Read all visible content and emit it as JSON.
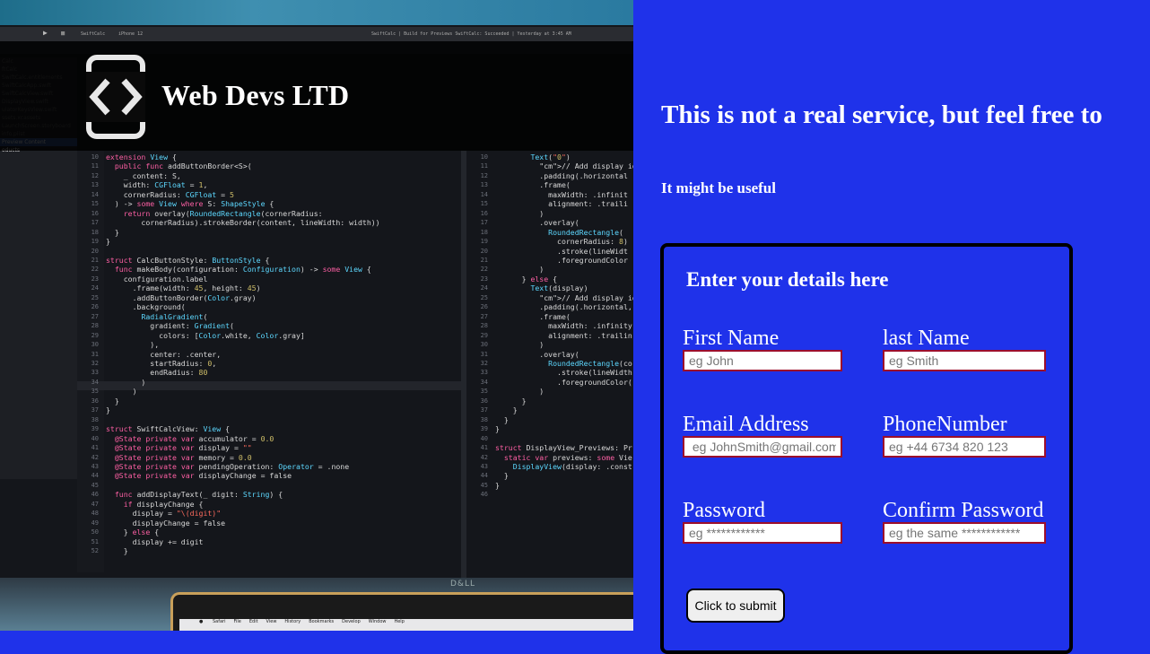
{
  "brand": {
    "name": "Web Devs LTD",
    "logo_icon": "code-device-icon"
  },
  "background_photo": {
    "window_title": "SwiftCalc | Build for Previews SwiftCalc: Succeeded | Yesterday at 3:45 AM",
    "device": "iPhone 12",
    "scheme": "SwiftCalc",
    "bezel_brand": "D&LL",
    "files": [
      "Calc",
      "ftCalc",
      "SwiftCalc.entitlements",
      "SwiftCalcApp.swift",
      "SwiftCalcView.swift",
      "DisplayView.swift",
      "ulatorKeysView.swift",
      "ssets.xcassets",
      "LaunchScreen.storyboard",
      "info.plist",
      "Preview Content",
      "oducts"
    ],
    "editor_left_start_line": 10,
    "editor_left_lines": [
      "extension View {",
      "  public func addButtonBorder<S>(",
      "    _ content: S,",
      "    width: CGFloat = 1,",
      "    cornerRadius: CGFloat = 5",
      "  ) -> some View where S: ShapeStyle {",
      "    return overlay(RoundedRectangle(cornerRadius:",
      "        cornerRadius).strokeBorder(content, lineWidth: width))",
      "  }",
      "}",
      "",
      "struct CalcButtonStyle: ButtonStyle {",
      "  func makeBody(configuration: Configuration) -> some View {",
      "    configuration.label",
      "      .frame(width: 45, height: 45)",
      "      .addButtonBorder(Color.gray)",
      "      .background(",
      "        RadialGradient(",
      "          gradient: Gradient(",
      "            colors: [Color.white, Color.gray]",
      "          ),",
      "          center: .center,",
      "          startRadius: 0,",
      "          endRadius: 80",
      "        )",
      "      )",
      "  }",
      "}",
      "",
      "struct SwiftCalcView: View {",
      "  @State private var accumulator = 0.0",
      "  @State private var display = \"\"",
      "  @State private var memory = 0.0",
      "  @State private var pendingOperation: Operator = .none",
      "  @State private var displayChange = false",
      "",
      "  func addDisplayText(_ digit: String) {",
      "    if displayChange {",
      "      display = \"\\(digit)\"",
      "      displayChange = false",
      "    } else {",
      "      display += digit",
      "    }"
    ],
    "editor_right_start_line": 10,
    "editor_right_lines": [
      "        Text(\"0\")",
      "          // Add display ident",
      "          .padding(.horizontal",
      "          .frame(",
      "            maxWidth: .infinit",
      "            alignment: .traili",
      "          )",
      "          .overlay(",
      "            RoundedRectangle(",
      "              cornerRadius: 8)",
      "              .stroke(lineWidt",
      "              .foregroundColor",
      "          )",
      "      } else {",
      "        Text(display)",
      "          // Add display ident",
      "          .padding(.horizontal,",
      "          .frame(",
      "            maxWidth: .infinity",
      "            alignment: .trailin",
      "          )",
      "          .overlay(",
      "            RoundedRectangle(co",
      "              .stroke(lineWidth",
      "              .foregroundColor(",
      "          )",
      "      }",
      "    }",
      "  }",
      "}",
      "",
      "struct DisplayView_Previews: Pr",
      "  static var previews: some Vie",
      "    DisplayView(display: .const",
      "  }",
      "}",
      ""
    ],
    "menubar": [
      "Safari",
      "File",
      "Edit",
      "View",
      "History",
      "Bookmarks",
      "Develop",
      "Window",
      "Help"
    ]
  },
  "main": {
    "headline": "This is not a real service, but feel free to",
    "subheadline": "It might be useful"
  },
  "form": {
    "title": "Enter your details here",
    "fields": {
      "first_name": {
        "label": "First Name",
        "placeholder": "eg John"
      },
      "last_name": {
        "label": "last Name",
        "placeholder": "eg Smith"
      },
      "email": {
        "label": "Email Address",
        "placeholder": " eg JohnSmith@gmail.com"
      },
      "phone": {
        "label": "PhoneNumber",
        "placeholder": "eg +44 6734 820 123"
      },
      "password": {
        "label": "Password",
        "placeholder": "eg ************"
      },
      "confirm_password": {
        "label": "Confirm Password",
        "placeholder": "eg the same ************"
      }
    },
    "submit_label": "Click to submit"
  },
  "colors": {
    "panel_bg": "#1f32ea",
    "input_border": "#9c0f2c",
    "text": "#ffffff"
  }
}
